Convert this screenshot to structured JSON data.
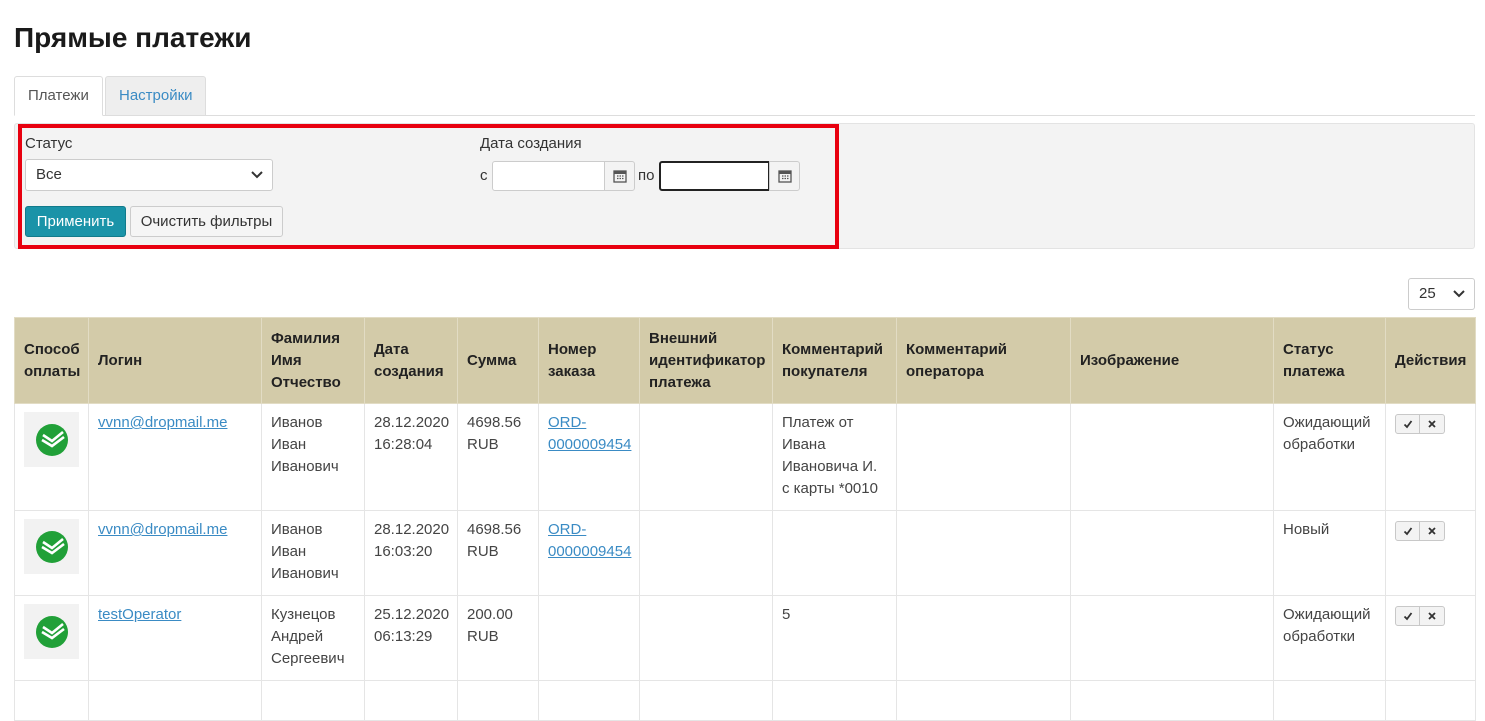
{
  "page_title": "Прямые платежи",
  "tabs": [
    {
      "label": "Платежи",
      "active": true
    },
    {
      "label": "Настройки",
      "active": false
    }
  ],
  "filters": {
    "status_label": "Статус",
    "status_value": "Все",
    "date_label": "Дата создания",
    "from_label": "с",
    "to_label": "по",
    "from_value": "",
    "to_value": "",
    "apply_label": "Применить",
    "clear_label": "Очистить фильтры"
  },
  "pagination": {
    "per_page": "25"
  },
  "colors": {
    "accent": "#1a93a8",
    "header_bg": "#d3cba9",
    "link": "#3a8bc4",
    "highlight": "#e8000f",
    "logo_green": "#21a038"
  },
  "table": {
    "headers": [
      "Способ оплаты",
      "Логин",
      "Фамилия Имя Отчество",
      "Дата создания",
      "Сумма",
      "Номер заказа",
      "Внешний идентификатор платежа",
      "Комментарий покупателя",
      "Комментарий оператора",
      "Изображение",
      "Статус платежа",
      "Действия"
    ],
    "rows": [
      {
        "method_icon": "sberbank-logo-icon",
        "login": "vvnn@dropmail.me",
        "fio": "Иванов Иван Иванович",
        "date": "28.12.2020 16:28:04",
        "amount": "4698.56 RUB",
        "order": "ORD-0000009454",
        "external_id": "",
        "customer_comment": "Платеж от Ивана Ивановича И. с карты *0010",
        "operator_comment": "",
        "image": "",
        "status": "Ожидающий обработки"
      },
      {
        "method_icon": "sberbank-logo-icon",
        "login": "vvnn@dropmail.me",
        "fio": "Иванов Иван Иванович",
        "date": "28.12.2020 16:03:20",
        "amount": "4698.56 RUB",
        "order": "ORD-0000009454",
        "external_id": "",
        "customer_comment": "",
        "operator_comment": "",
        "image": "",
        "status": "Новый"
      },
      {
        "method_icon": "sberbank-logo-icon",
        "login": "testOperator",
        "fio": "Кузнецов Андрей Сергеевич",
        "date": "25.12.2020 06:13:29",
        "amount": "200.00 RUB",
        "order": "",
        "external_id": "",
        "customer_comment": "5",
        "operator_comment": "",
        "image": "",
        "status": "Ожидающий обработки"
      }
    ]
  }
}
